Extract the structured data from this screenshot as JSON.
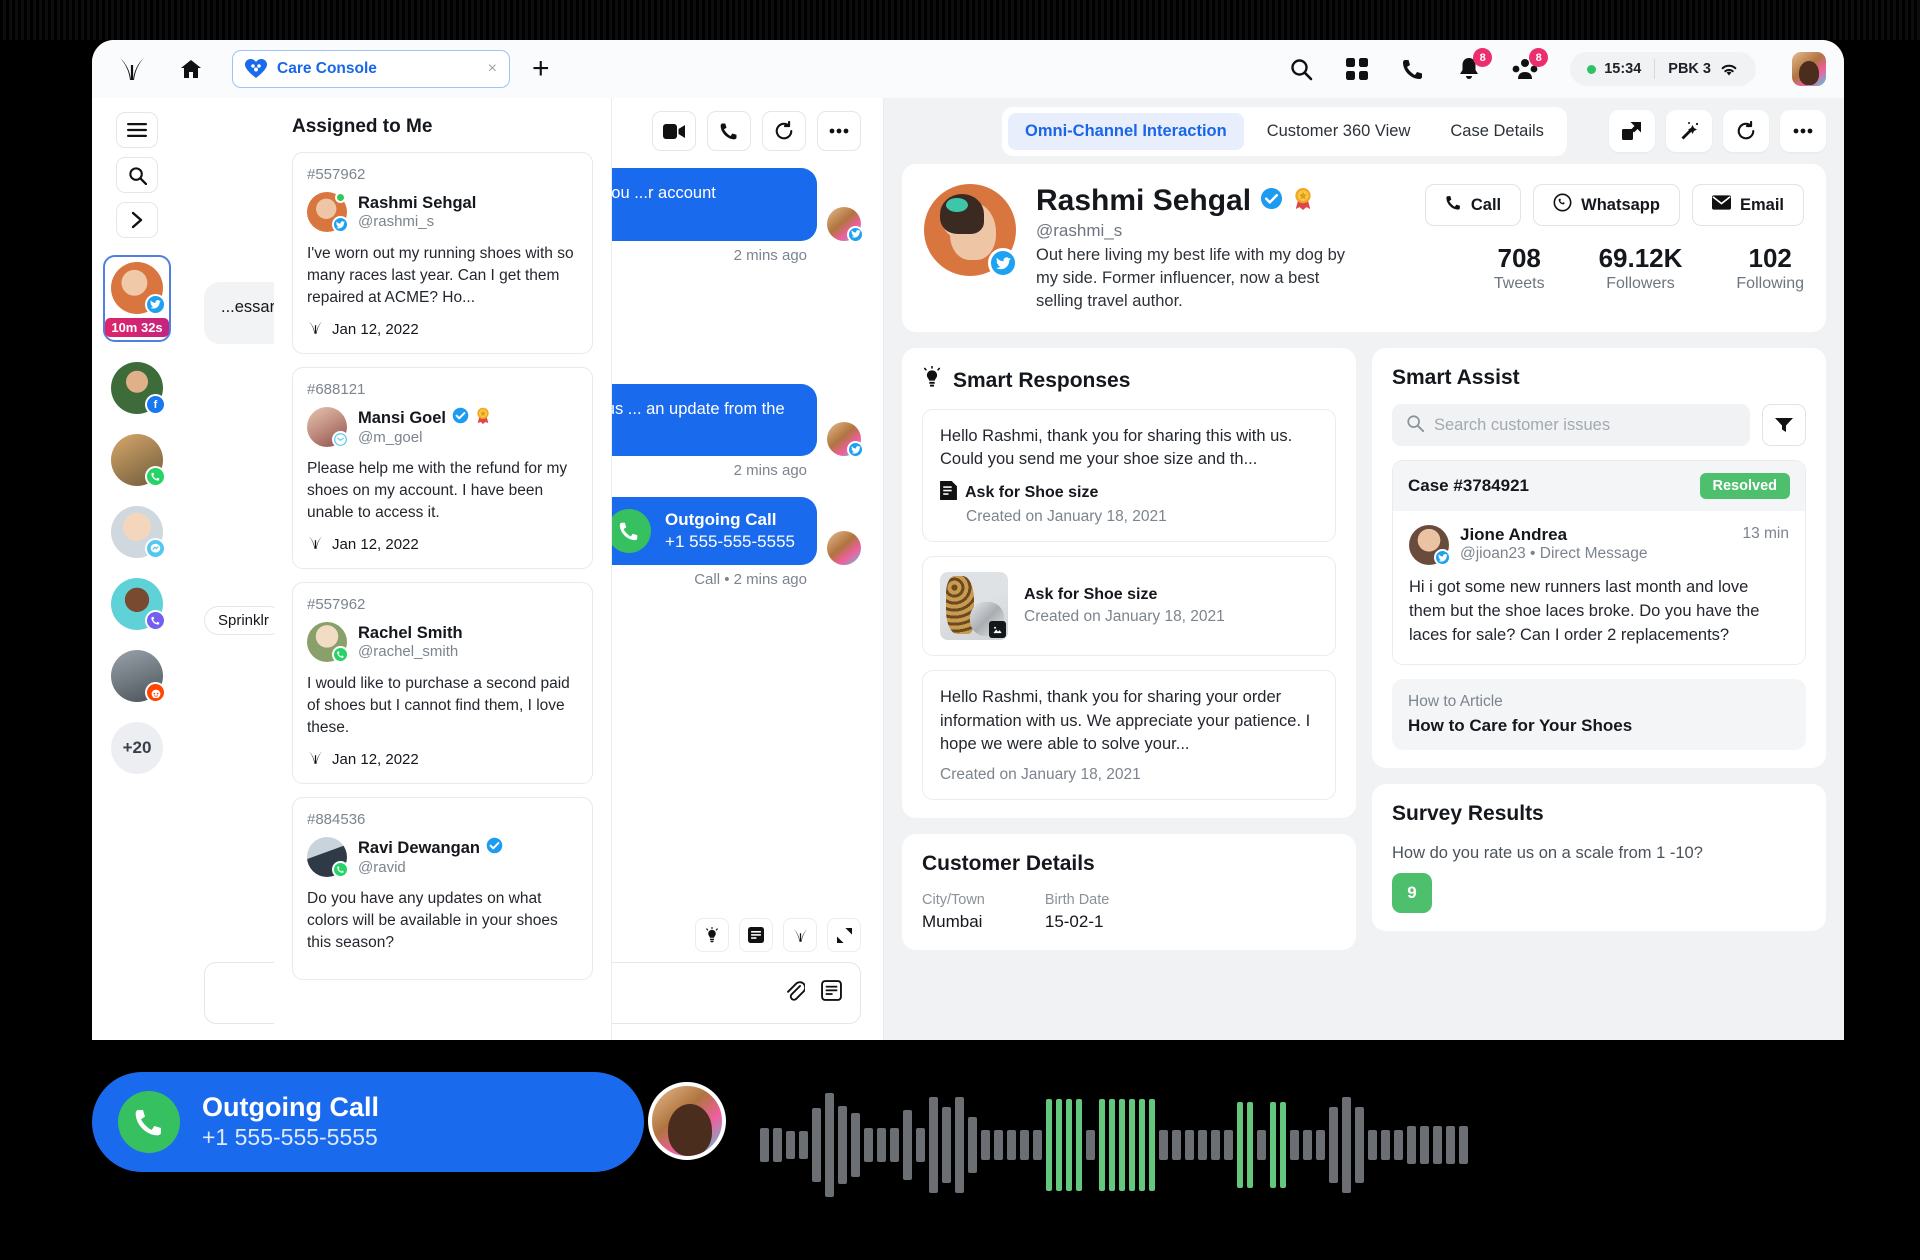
{
  "topbar": {
    "tab_label": "Care Console",
    "tab_close": "×",
    "new_tab": "+",
    "icons": [
      "search-icon",
      "grid-icon",
      "phone-icon",
      "bell-icon",
      "people-icon"
    ],
    "bell_badge": "8",
    "people_badge": "8",
    "time": "15:34",
    "device": "PBK 3"
  },
  "rail": {
    "buttons": [
      "menu-icon",
      "search-icon",
      "chevron-right-icon"
    ],
    "active_timer": "10m 32s",
    "more_count": "+20",
    "channels": [
      "twitter",
      "facebook",
      "whatsapp",
      "messenger",
      "viber",
      "reddit"
    ]
  },
  "assigned": {
    "title": "Assigned to Me",
    "cases": [
      {
        "id": "#557962",
        "name": "Rashmi Sehgal",
        "handle": "@rashmi_s",
        "text": "I've worn out my running shoes with so many races last year. Can I get them repaired at ACME? Ho...",
        "date": "Jan 12, 2022",
        "channel": "twitter",
        "online": true,
        "verified": false,
        "award": false
      },
      {
        "id": "#688121",
        "name": "Mansi Goel",
        "handle": "@m_goel",
        "text": "Please help me with the refund for my shoes on my account. I have been unable to access it.",
        "date": "Jan 12, 2022",
        "channel": "messenger",
        "online": false,
        "verified": true,
        "award": true
      },
      {
        "id": "#557962",
        "name": "Rachel Smith",
        "handle": "@rachel_smith",
        "text": "I would like to purchase a second paid of shoes but I cannot find them, I love these.",
        "date": "Jan 12, 2022",
        "channel": "whatsapp",
        "online": false,
        "verified": false,
        "award": false
      },
      {
        "id": "#884536",
        "name": "Ravi Dewangan",
        "handle": "@ravid",
        "text": "Do you have any updates on what colors will be available in your shoes this season?",
        "date": "Jan 12, 2022",
        "channel": "whatsapp",
        "online": false,
        "verified": true,
        "award": false
      }
    ]
  },
  "conversation": {
    "header_icons": [
      "video-icon",
      "phone-icon",
      "refresh-icon",
      "more-icon"
    ],
    "messages": [
      {
        "dir": "out",
        "text": "...hing out to ACME. Could you ...r account information?",
        "meta": "2 mins ago"
      },
      {
        "dir": "in",
        "text": "...essary",
        "meta": ""
      },
      {
        "dir": "out",
        "text": "...onfirmation. Please allow us ... an update from the team.",
        "meta": "2 mins ago"
      }
    ],
    "call_event": {
      "title": "Outgoing Call",
      "number": "+1 555-555-5555",
      "meta": "Call • 2 mins ago"
    },
    "chip": "Sprinklr",
    "compose_tools": [
      "bulb-icon",
      "note-icon",
      "sprinklr-icon",
      "expand-icon"
    ],
    "composer_icons": [
      "attachment-icon",
      "template-icon"
    ]
  },
  "work": {
    "tabs": [
      {
        "label": "Omni-Channel Interaction",
        "active": true
      },
      {
        "label": "Customer 360 View",
        "active": false
      },
      {
        "label": "Case Details",
        "active": false
      }
    ],
    "actions": [
      "popout-icon",
      "magic-wand-icon",
      "refresh-icon",
      "more-icon"
    ]
  },
  "profile": {
    "name": "Rashmi Sehgal",
    "handle": "@rashmi_s",
    "bio": "Out here living my best life with my dog by my side. Former influencer, now a best selling travel author.",
    "verified": true,
    "award": true,
    "buttons": [
      {
        "label": "Call",
        "icon": "phone-icon"
      },
      {
        "label": "Whatsapp",
        "icon": "whatsapp-icon"
      },
      {
        "label": "Email",
        "icon": "mail-icon"
      }
    ],
    "stats": [
      {
        "value": "708",
        "label": "Tweets"
      },
      {
        "value": "69.12K",
        "label": "Followers"
      },
      {
        "value": "102",
        "label": "Following"
      }
    ]
  },
  "smart_responses": {
    "title": "Smart Responses",
    "icon": "bulb-icon",
    "items": [
      {
        "type": "text",
        "text": "Hello Rashmi, thank you for sharing this with us. Could you send me your shoe size and th...",
        "asset": "Ask for Shoe size",
        "created": "Created on January 18, 2021"
      },
      {
        "type": "media",
        "asset": "Ask for Shoe size",
        "created": "Created on January 18, 2021"
      },
      {
        "type": "text-only",
        "text": "Hello Rashmi, thank you for sharing your order information with us. We appreciate your patience. I hope we were able to solve your...",
        "created": "Created on January 18, 2021"
      }
    ]
  },
  "smart_assist": {
    "title": "Smart Assist",
    "search_placeholder": "Search customer issues",
    "search_value": "",
    "filter_icon": "filter-icon",
    "case": {
      "number": "Case #3784921",
      "status": "Resolved",
      "status_color": "#4ec06d",
      "name": "Jione Andrea",
      "handle": "@jioan23",
      "source": "Direct Message",
      "time": "13 min",
      "message": "Hi i got some new runners last month and love them but the shoe laces broke. Do you have the laces for sale? Can I order 2 replacements?"
    },
    "article": {
      "kicker": "How to Article",
      "title": "How to Care for Your Shoes"
    }
  },
  "customer_details": {
    "title": "Customer Details",
    "fields": [
      {
        "key": "City/Town",
        "value": "Mumbai"
      },
      {
        "key": "Birth Date",
        "value": "15-02-1"
      }
    ]
  },
  "survey": {
    "title": "Survey Results",
    "question": "How do you rate us on a scale from 1 -10?",
    "score": "9"
  },
  "call_toast": {
    "title": "Outgoing Call",
    "number": "+1 555-555-5555"
  }
}
